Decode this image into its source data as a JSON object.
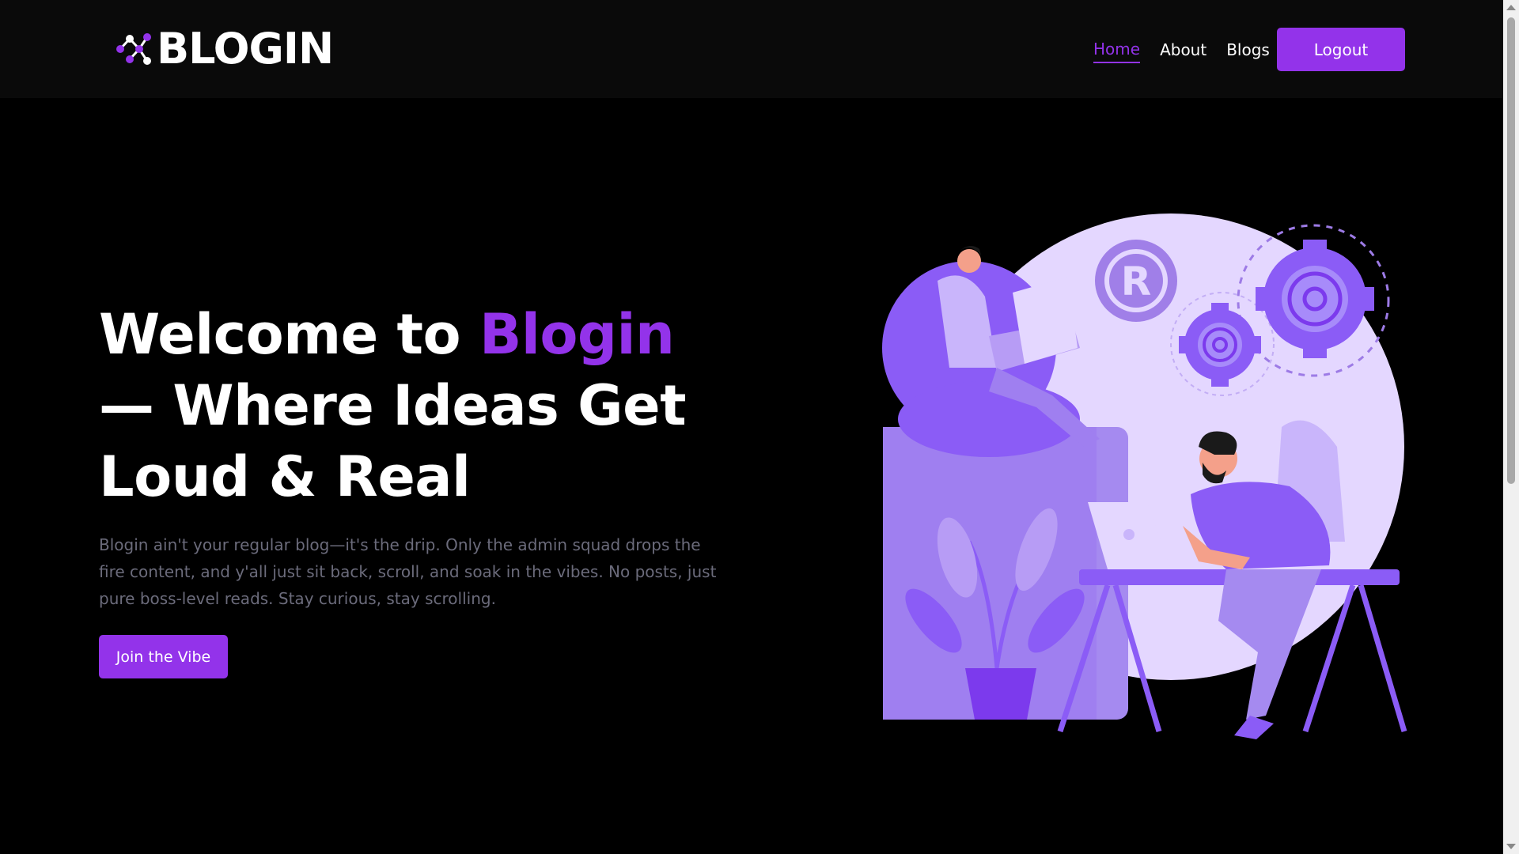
{
  "nav": {
    "logo_text": "BLOGIN",
    "links": [
      {
        "label": "Home",
        "active": true
      },
      {
        "label": "About",
        "active": false
      },
      {
        "label": "Blogs",
        "active": false
      }
    ],
    "logout_label": "Logout"
  },
  "hero": {
    "title_part1": "Welcome to ",
    "title_accent": "Blogin",
    "title_part2": " — Where Ideas Get Loud & Real",
    "description": "Blogin ain't your regular blog—it's the drip. Only the admin squad drops the fire content, and y'all just sit back, scroll, and soak in the vibes. No posts, just pure boss-level reads. Stay curious, stay scrolling.",
    "cta_label": "Join the Vibe",
    "illustration_badge": "R"
  },
  "colors": {
    "accent": "#9333ea",
    "background": "#000000",
    "navbar": "#0a0a0a",
    "muted_text": "#6b6b7b"
  }
}
